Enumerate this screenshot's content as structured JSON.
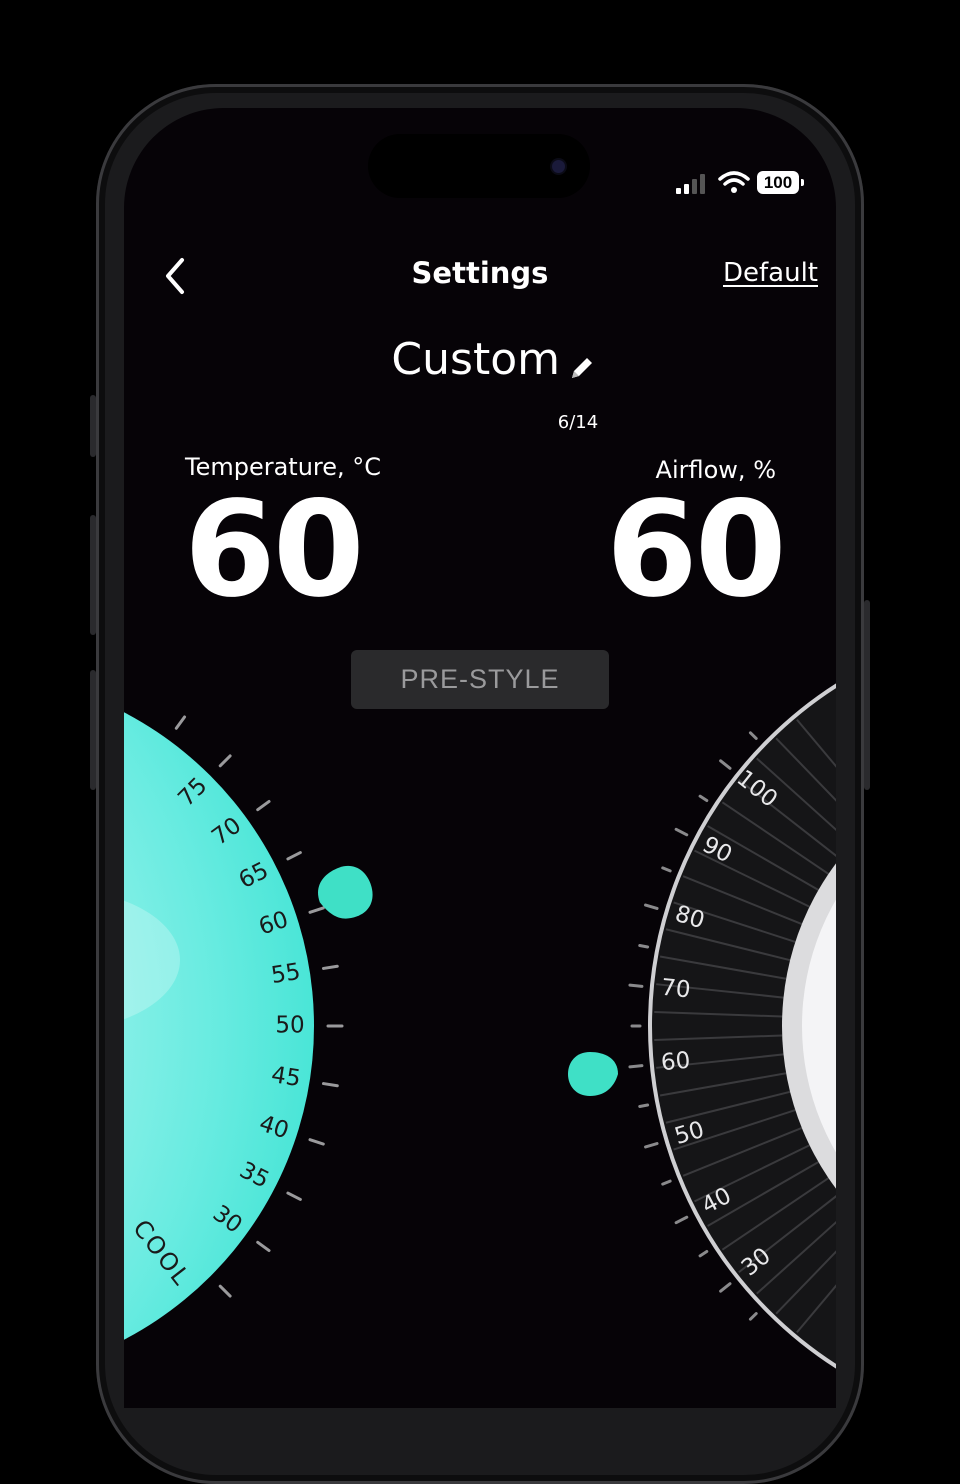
{
  "status_bar": {
    "battery": "100",
    "signal_icon": "signal-bars-icon",
    "wifi_icon": "wifi-icon"
  },
  "header": {
    "title": "Settings",
    "default_link": "Default",
    "back_icon": "chevron-left-icon"
  },
  "preset": {
    "name": "Custom",
    "edit_icon": "pencil-icon",
    "counter": "6/14"
  },
  "temperature": {
    "label": "Temperature, °C",
    "value": "60",
    "cool_label": "COOL",
    "ticks": [
      "75",
      "70",
      "65",
      "60",
      "55",
      "50",
      "45",
      "40",
      "35",
      "30"
    ]
  },
  "airflow": {
    "label": "Airflow, %",
    "value": "60",
    "ticks": [
      "100",
      "90",
      "80",
      "70",
      "60",
      "50",
      "40",
      "30"
    ]
  },
  "prestyle_button": "PRE-STYLE",
  "colors": {
    "accent": "#3fe0c6",
    "cool_glow": "#9ef6ef",
    "background": "#060307"
  }
}
